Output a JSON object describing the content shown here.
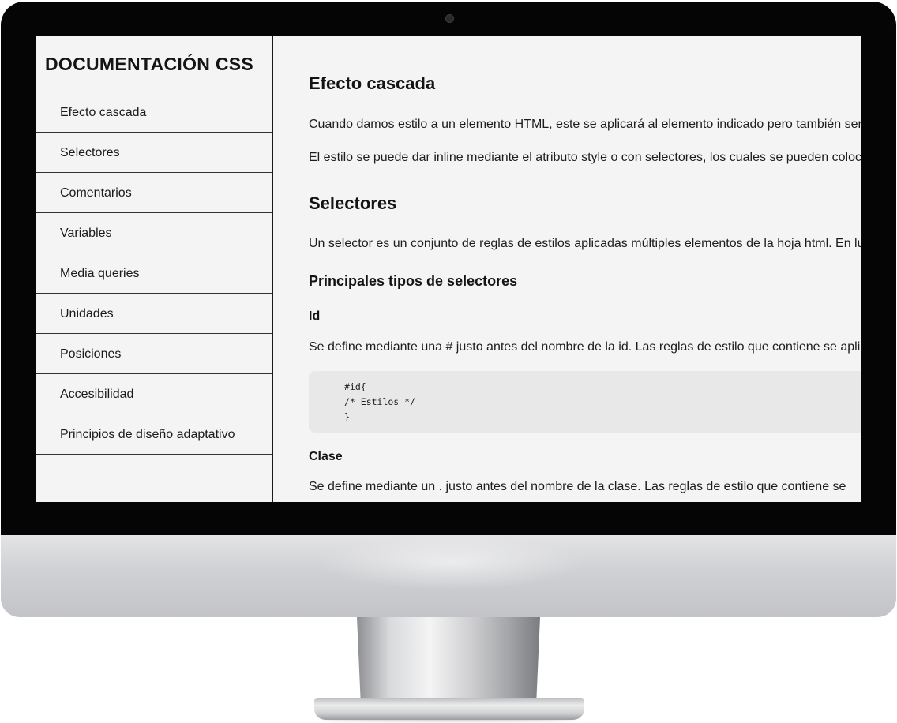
{
  "sidebar": {
    "title": "DOCUMENTACIÓN CSS",
    "items": [
      {
        "label": "Efecto cascada"
      },
      {
        "label": "Selectores"
      },
      {
        "label": "Comentarios"
      },
      {
        "label": "Variables"
      },
      {
        "label": "Media queries"
      },
      {
        "label": "Unidades"
      },
      {
        "label": "Posiciones"
      },
      {
        "label": "Accesibilidad"
      },
      {
        "label": "Principios de diseño adaptativo"
      }
    ]
  },
  "main": {
    "section_cascada": {
      "heading": "Efecto cascada",
      "paragraph_1": "Cuando damos estilo a un elemento HTML, este se aplicará al elemento indicado pero también ser",
      "paragraph_2": "El estilo se puede dar inline mediante el atributo style o con selectores, los cuales se pueden coloc"
    },
    "section_selectores": {
      "heading": "Selectores",
      "paragraph_1": "Un selector es un conjunto de reglas de estilos aplicadas múltiples elementos de la hoja html. En lu",
      "subheading": "Principales tipos de selectores",
      "id": {
        "title": "Id",
        "paragraph": "Se define mediante una # justo antes del nombre de la id. Las reglas de estilo que contiene se apli",
        "code": [
          "#id{",
          "/* Estilos */",
          "}"
        ]
      },
      "clase": {
        "title": "Clase",
        "paragraph": "Se define mediante un . justo antes del nombre de la clase. Las reglas de estilo que contiene se"
      }
    }
  },
  "colors": {
    "screen_background": "#f4f4f4",
    "bezel": "#050505",
    "code_background": "#e8e8e8",
    "text": "#141414"
  }
}
